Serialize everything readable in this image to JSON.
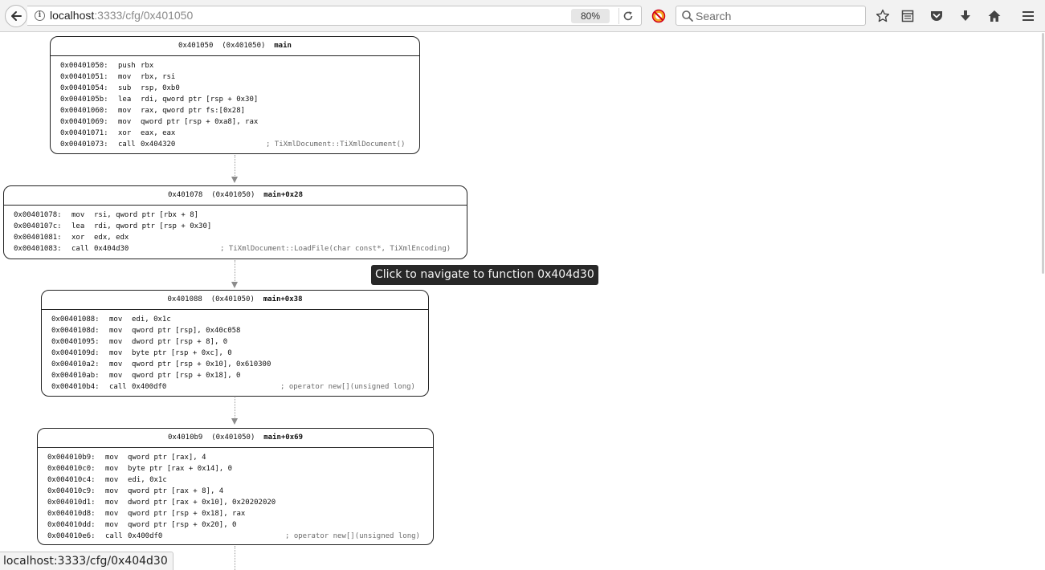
{
  "browser": {
    "url_host": "localhost",
    "url_rest": ":3333/cfg/0x401050",
    "zoom": "80%",
    "search_placeholder": "Search",
    "icons": {
      "back": "back-arrow-icon",
      "info": "info-icon",
      "reload": "reload-icon",
      "addon": "blocked-addon-icon",
      "search": "search-icon",
      "bookmark": "star-icon",
      "reader": "reading-list-icon",
      "pocket": "pocket-icon",
      "download": "download-icon",
      "home": "home-icon",
      "menu": "hamburger-menu-icon"
    }
  },
  "cfg": {
    "nodes": [
      {
        "addr": "0x401050",
        "func": "(0x401050)",
        "label": "main",
        "insns": [
          {
            "addr": "0x00401050:",
            "mnem": "push",
            "ops": "rbx",
            "comment": ""
          },
          {
            "addr": "0x00401051:",
            "mnem": "mov",
            "ops": "rbx, rsi",
            "comment": ""
          },
          {
            "addr": "0x00401054:",
            "mnem": "sub",
            "ops": "rsp, 0xb0",
            "comment": ""
          },
          {
            "addr": "0x0040105b:",
            "mnem": "lea",
            "ops": "rdi, qword ptr [rsp + 0x30]",
            "comment": ""
          },
          {
            "addr": "0x00401060:",
            "mnem": "mov",
            "ops": "rax, qword ptr fs:[0x28]",
            "comment": ""
          },
          {
            "addr": "0x00401069:",
            "mnem": "mov",
            "ops": "qword ptr [rsp + 0xa8], rax",
            "comment": ""
          },
          {
            "addr": "0x00401071:",
            "mnem": "xor",
            "ops": "eax, eax",
            "comment": ""
          },
          {
            "addr": "0x00401073:",
            "mnem": "call",
            "ops": "0x404320",
            "comment": "; TiXmlDocument::TiXmlDocument()"
          }
        ]
      },
      {
        "addr": "0x401078",
        "func": "(0x401050)",
        "label": "main+0x28",
        "insns": [
          {
            "addr": "0x00401078:",
            "mnem": "mov",
            "ops": "rsi, qword ptr [rbx + 8]",
            "comment": ""
          },
          {
            "addr": "0x0040107c:",
            "mnem": "lea",
            "ops": "rdi, qword ptr [rsp + 0x30]",
            "comment": ""
          },
          {
            "addr": "0x00401081:",
            "mnem": "xor",
            "ops": "edx, edx",
            "comment": ""
          },
          {
            "addr": "0x00401083:",
            "mnem": "call",
            "ops": "0x404d30",
            "comment": "; TiXmlDocument::LoadFile(char const*, TiXmlEncoding)"
          }
        ]
      },
      {
        "addr": "0x401088",
        "func": "(0x401050)",
        "label": "main+0x38",
        "insns": [
          {
            "addr": "0x00401088:",
            "mnem": "mov",
            "ops": "edi, 0x1c",
            "comment": ""
          },
          {
            "addr": "0x0040108d:",
            "mnem": "mov",
            "ops": "qword ptr [rsp], 0x40c058",
            "comment": ""
          },
          {
            "addr": "0x00401095:",
            "mnem": "mov",
            "ops": "dword ptr [rsp + 8], 0",
            "comment": ""
          },
          {
            "addr": "0x0040109d:",
            "mnem": "mov",
            "ops": "byte ptr [rsp + 0xc], 0",
            "comment": ""
          },
          {
            "addr": "0x004010a2:",
            "mnem": "mov",
            "ops": "qword ptr [rsp + 0x10], 0x610300",
            "comment": ""
          },
          {
            "addr": "0x004010ab:",
            "mnem": "mov",
            "ops": "qword ptr [rsp + 0x18], 0",
            "comment": ""
          },
          {
            "addr": "0x004010b4:",
            "mnem": "call",
            "ops": "0x400df0",
            "comment": "; operator new[](unsigned long)"
          }
        ]
      },
      {
        "addr": "0x4010b9",
        "func": "(0x401050)",
        "label": "main+0x69",
        "insns": [
          {
            "addr": "0x004010b9:",
            "mnem": "mov",
            "ops": "qword ptr [rax], 4",
            "comment": ""
          },
          {
            "addr": "0x004010c0:",
            "mnem": "mov",
            "ops": "byte ptr [rax + 0x14], 0",
            "comment": ""
          },
          {
            "addr": "0x004010c4:",
            "mnem": "mov",
            "ops": "edi, 0x1c",
            "comment": ""
          },
          {
            "addr": "0x004010c9:",
            "mnem": "mov",
            "ops": "qword ptr [rax + 8], 4",
            "comment": ""
          },
          {
            "addr": "0x004010d1:",
            "mnem": "mov",
            "ops": "dword ptr [rax + 0x10], 0x20202020",
            "comment": ""
          },
          {
            "addr": "0x004010d8:",
            "mnem": "mov",
            "ops": "qword ptr [rsp + 0x18], rax",
            "comment": ""
          },
          {
            "addr": "0x004010dd:",
            "mnem": "mov",
            "ops": "qword ptr [rsp + 0x20], 0",
            "comment": ""
          },
          {
            "addr": "0x004010e6:",
            "mnem": "call",
            "ops": "0x400df0",
            "comment": "; operator new[](unsigned long)"
          }
        ]
      }
    ]
  },
  "tooltip": "Click to navigate to function 0x404d30",
  "status_url": "localhost:3333/cfg/0x404d30"
}
